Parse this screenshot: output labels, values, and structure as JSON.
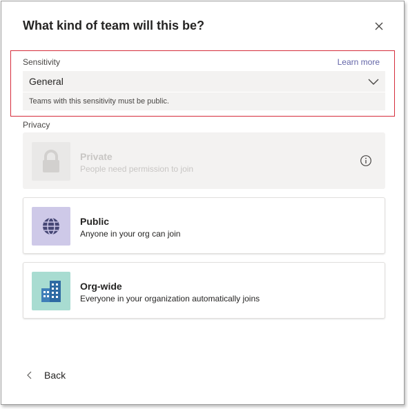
{
  "dialog": {
    "title": "What kind of team will this be?"
  },
  "sensitivity": {
    "label": "Sensitivity",
    "learn_more": "Learn more",
    "selected": "General",
    "helper": "Teams with this sensitivity must be public."
  },
  "privacy": {
    "label": "Privacy",
    "options": [
      {
        "name": "Private",
        "desc": "People need permission to join",
        "disabled": true,
        "icon": "lock-icon"
      },
      {
        "name": "Public",
        "desc": "Anyone in your org can join",
        "disabled": false,
        "icon": "globe-icon"
      },
      {
        "name": "Org-wide",
        "desc": "Everyone in your organization automatically joins",
        "disabled": false,
        "icon": "building-icon"
      }
    ]
  },
  "footer": {
    "back_label": "Back"
  },
  "colors": {
    "accent": "#6264a7",
    "highlight_border": "#d52b3a",
    "public_tile": "#cec9e8",
    "orgwide_tile": "#a8dcd1"
  }
}
